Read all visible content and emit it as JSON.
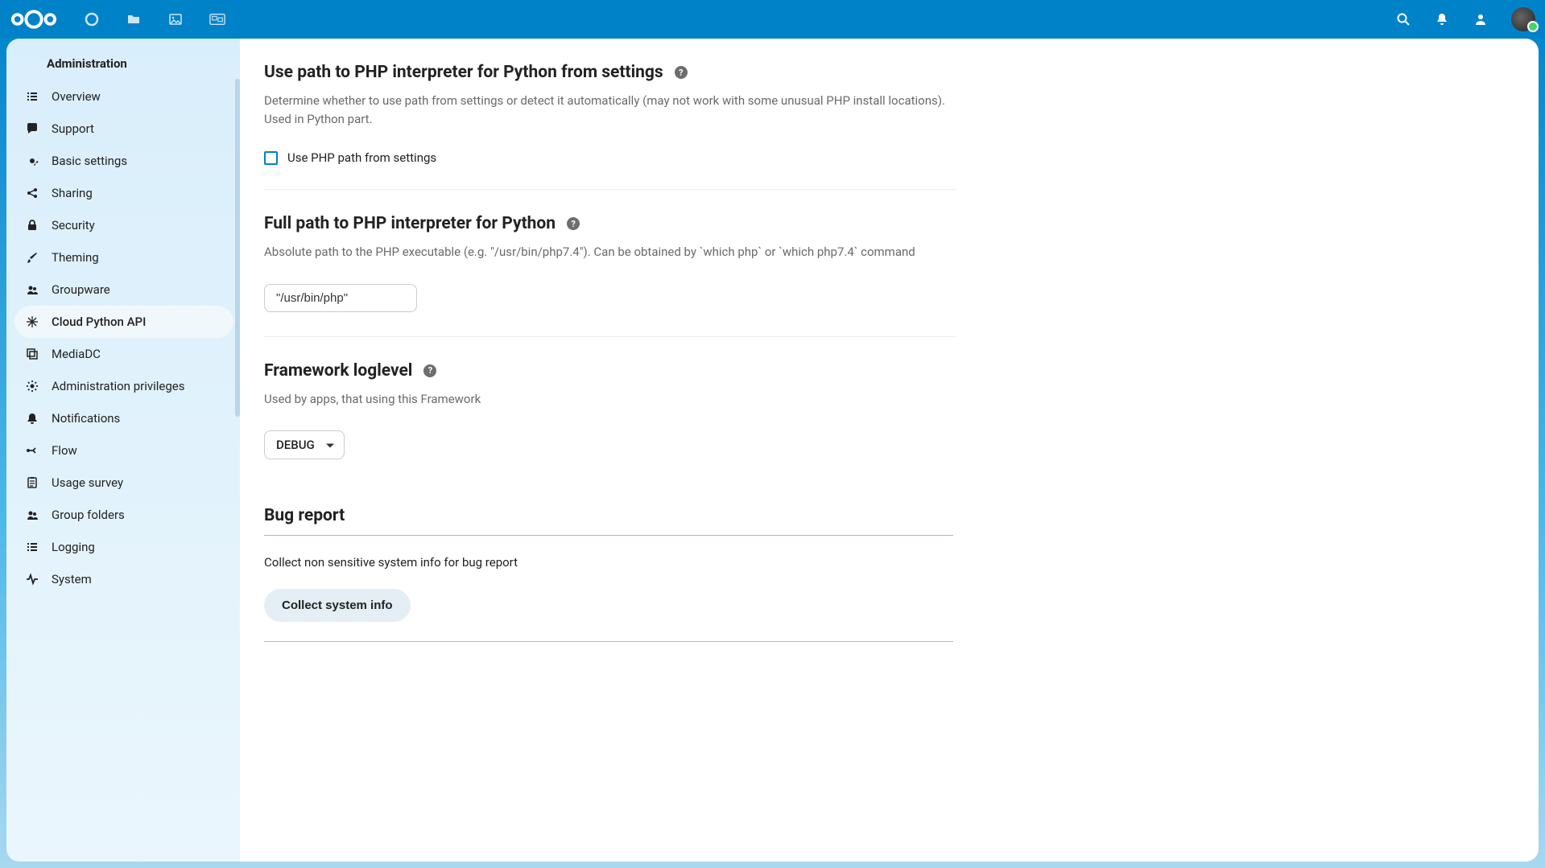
{
  "header": {
    "app_icons": [
      "dashboard",
      "files",
      "photos",
      "media"
    ],
    "right_icons": [
      "search",
      "notifications",
      "contacts"
    ]
  },
  "sidebar": {
    "heading": "Administration",
    "items": [
      {
        "icon": "list",
        "label": "Overview"
      },
      {
        "icon": "chat",
        "label": "Support"
      },
      {
        "icon": "gear",
        "label": "Basic settings"
      },
      {
        "icon": "share",
        "label": "Sharing"
      },
      {
        "icon": "lock",
        "label": "Security"
      },
      {
        "icon": "brush",
        "label": "Theming"
      },
      {
        "icon": "group",
        "label": "Groupware"
      },
      {
        "icon": "snowflake",
        "label": "Cloud Python API",
        "active": true
      },
      {
        "icon": "duplicate",
        "label": "MediaDC"
      },
      {
        "icon": "gear",
        "label": "Administration privileges"
      },
      {
        "icon": "bell",
        "label": "Notifications"
      },
      {
        "icon": "flow",
        "label": "Flow"
      },
      {
        "icon": "clipboard",
        "label": "Usage survey"
      },
      {
        "icon": "group",
        "label": "Group folders"
      },
      {
        "icon": "list",
        "label": "Logging"
      },
      {
        "icon": "activity",
        "label": "System"
      }
    ]
  },
  "sections": {
    "php_path_toggle": {
      "title": "Use path to PHP interpreter for Python from settings",
      "desc": "Determine whether to use path from settings or detect it automatically (may not work with some unusual PHP install locations). Used in Python part.",
      "checkbox_label": "Use PHP path from settings"
    },
    "php_path_full": {
      "title": "Full path to PHP interpreter for Python",
      "desc": "Absolute path to the PHP executable (e.g. \"/usr/bin/php7.4\"). Can be obtained by `which php` or `which php7.4` command",
      "value": "\"/usr/bin/php\""
    },
    "loglevel": {
      "title": "Framework loglevel",
      "desc": "Used by apps, that using this Framework",
      "value": "DEBUG"
    },
    "bug": {
      "title": "Bug report",
      "desc": "Collect non sensitive system info for bug report",
      "button": "Collect system info"
    }
  }
}
